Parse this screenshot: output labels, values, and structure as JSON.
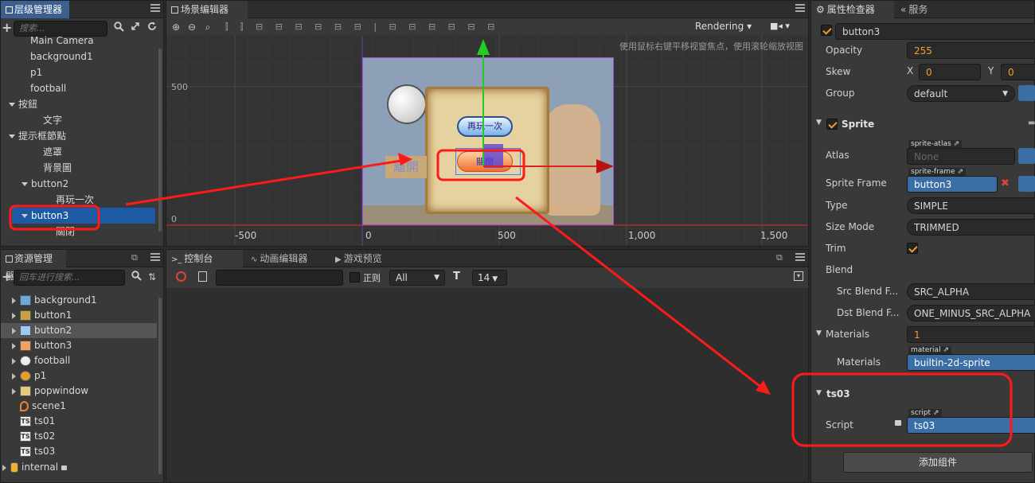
{
  "hierarchy": {
    "tab": "层级管理器",
    "search_placeholder": "搜索...",
    "items": [
      {
        "label": "Main Camera",
        "indent": 0,
        "expanded": null
      },
      {
        "label": "background1",
        "indent": 0,
        "expanded": null
      },
      {
        "label": "p1",
        "indent": 0,
        "expanded": null
      },
      {
        "label": "football",
        "indent": 0,
        "expanded": null
      },
      {
        "label": "按鈕",
        "indent": 0,
        "expanded": true
      },
      {
        "label": "文字",
        "indent": 1,
        "expanded": null
      },
      {
        "label": "提示框節點",
        "indent": 0,
        "expanded": true
      },
      {
        "label": "遮罩",
        "indent": 1,
        "expanded": null
      },
      {
        "label": "背景圖",
        "indent": 1,
        "expanded": null
      },
      {
        "label": "button2",
        "indent": 1,
        "expanded": true
      },
      {
        "label": "再玩一次",
        "indent": 2,
        "expanded": null
      },
      {
        "label": "button3",
        "indent": 1,
        "expanded": true,
        "selected": true
      },
      {
        "label": "關閉",
        "indent": 2,
        "expanded": null
      }
    ]
  },
  "assets": {
    "tab": "资源管理器",
    "search_placeholder": "回车进行搜索...",
    "items": [
      {
        "label": "background1",
        "icon": "image-icon",
        "color": "#6fa8dc",
        "selected": false
      },
      {
        "label": "button1",
        "icon": "image-icon",
        "color": "#c8a040",
        "selected": false
      },
      {
        "label": "button2",
        "icon": "image-icon",
        "color": "#9ec9f0",
        "selected": true
      },
      {
        "label": "button3",
        "icon": "image-icon",
        "color": "#f0a060",
        "selected": false
      },
      {
        "label": "football",
        "icon": "football-icon",
        "color": "#eeeeee",
        "selected": false
      },
      {
        "label": "p1",
        "icon": "character-icon",
        "color": "#e0a030",
        "selected": false
      },
      {
        "label": "popwindow",
        "icon": "image-icon",
        "color": "#e8c880",
        "selected": false
      },
      {
        "label": "scene1",
        "icon": "scene-icon",
        "color": "#f08030",
        "selected": false
      },
      {
        "label": "ts01",
        "icon": "ts-icon",
        "color": "#dddddd",
        "selected": false
      },
      {
        "label": "ts02",
        "icon": "ts-icon",
        "color": "#dddddd",
        "selected": false
      },
      {
        "label": "ts03",
        "icon": "ts-icon",
        "color": "#dddddd",
        "selected": false
      }
    ],
    "internal_label": "internal"
  },
  "scene": {
    "tab": "场景编辑器",
    "render_mode": "Rendering",
    "hint": "使用鼠标右键平移视窗焦点，使用滚轮缩放视图",
    "axis_y_500": "500",
    "axis_y_0": "0",
    "axis_x_labels": [
      "-500",
      "0",
      "500",
      "1,000",
      "1,500"
    ],
    "btn_replay": "再玩一次",
    "btn_close": "關閉",
    "btn_leave": "離開"
  },
  "console": {
    "tabs": [
      "控制台",
      "动画编辑器",
      "游戏预览"
    ],
    "regex_label": "正则",
    "filter_value": "All",
    "font_size": "14"
  },
  "inspector": {
    "tabs": [
      "属性检查器",
      "服务"
    ],
    "node_name": "button3",
    "opacity_label": "Opacity",
    "opacity_value": "255",
    "skew_label": "Skew",
    "skew_x_label": "X",
    "skew_x_value": "0",
    "skew_y_label": "Y",
    "skew_y_value": "0",
    "group_label": "Group",
    "group_value": "default",
    "sprite_title": "Sprite",
    "atlas_label": "Atlas",
    "atlas_tag": "sprite-atlas",
    "atlas_value": "None",
    "sprite_frame_label": "Sprite Frame",
    "sprite_frame_tag": "sprite-frame",
    "sprite_frame_value": "button3",
    "type_label": "Type",
    "type_value": "SIMPLE",
    "size_mode_label": "Size Mode",
    "size_mode_value": "TRIMMED",
    "trim_label": "Trim",
    "blend_label": "Blend",
    "src_blend_label": "Src Blend F...",
    "src_blend_value": "SRC_ALPHA",
    "dst_blend_label": "Dst Blend F...",
    "dst_blend_value": "ONE_MINUS_SRC_ALPHA",
    "materials_label": "Materials",
    "materials_count": "1",
    "materials_item_label": "Materials",
    "material_tag": "material",
    "material_value": "builtin-2d-sprite",
    "ts03_title": "ts03",
    "script_label": "Script",
    "script_tag": "script",
    "script_value": "ts03",
    "add_component": "添加组件"
  },
  "colors": {
    "selection": "#1c5aa6",
    "annotation_red": "#ff1a1a",
    "accent_orange": "#f29b2e",
    "field_blue": "#3b6ea5"
  }
}
